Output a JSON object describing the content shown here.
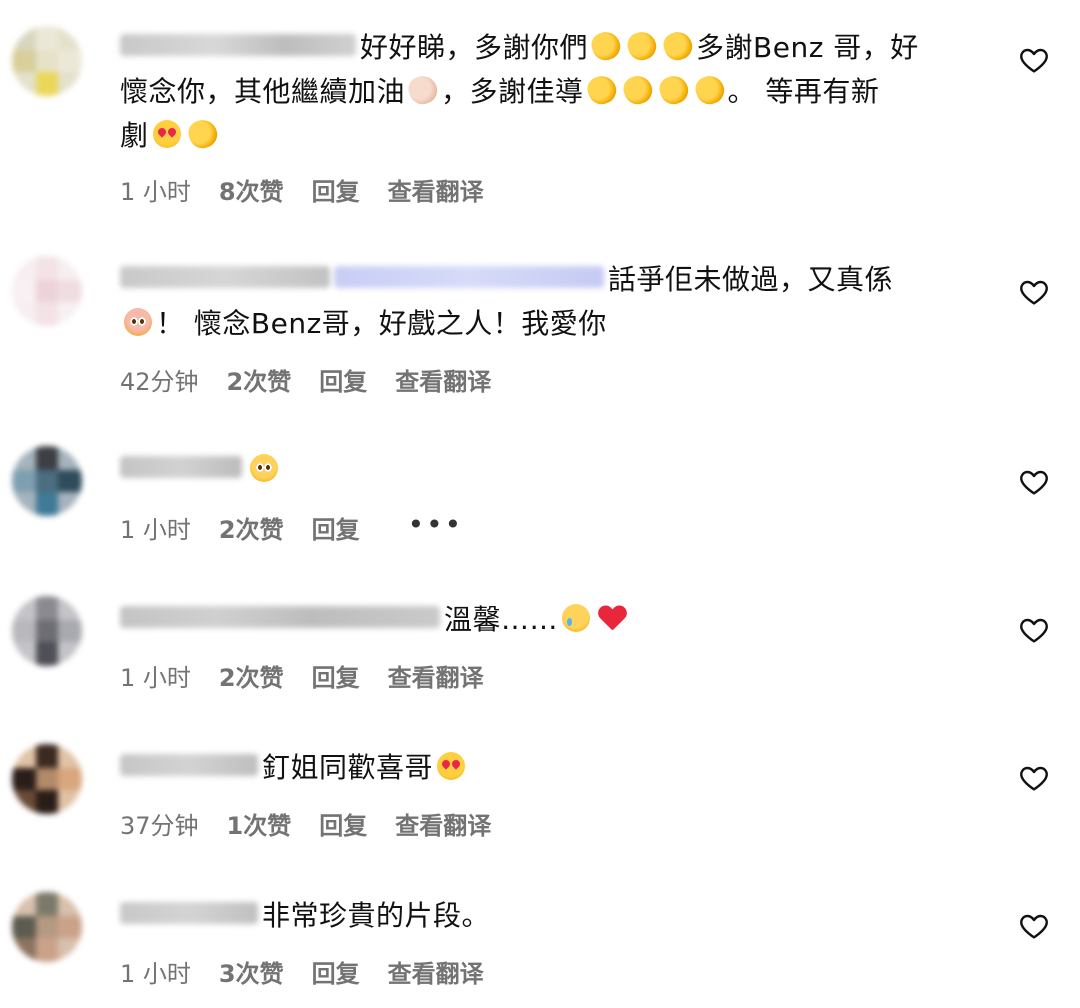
{
  "comments": [
    {
      "name_blur_colors": [
        "#c8c8c8",
        "#d8d8d8"
      ],
      "avatar_colors": [
        "#d9d6bf",
        "#ece8d8",
        "#d8cf9a",
        "#e6e2c8",
        "#ead75a",
        "#e4e1cb"
      ],
      "text_part1": "好好睇，多謝你們",
      "text_part2": "多謝Benz 哥，好",
      "text_line2a": "懷念你，其他繼續加油",
      "text_line2b": "，多謝佳導",
      "text_line2c": "。 等再有新",
      "text_line3": "劇",
      "time": "1 小时",
      "likes": "8次赞",
      "reply": "回复",
      "translate": "查看翻译"
    },
    {
      "name_blur_colors": [
        "#c9c9c9",
        "#c8cdf5"
      ],
      "avatar_colors": [
        "#f3e2e6",
        "#f6eef0",
        "#ecd3da",
        "#f8f0f2",
        "#f0dde2",
        "#f7eef0"
      ],
      "text_part1": "話爭佢未做過，又真係",
      "text_line2": "！ 懷念Benz哥，好戲之人！我愛你",
      "time": "42分钟",
      "likes": "2次赞",
      "reply": "回复",
      "translate": "查看翻译"
    },
    {
      "name_blur_colors": [
        "#c4c4c4"
      ],
      "avatar_colors": [
        "#3c3f44",
        "#4b6d80",
        "#2f4b5c",
        "#7d9fb0",
        "#3f7a96",
        "#a5b3bd"
      ],
      "time": "1 小时",
      "likes": "2次赞",
      "reply": "回复",
      "more": "•••"
    },
    {
      "name_blur_colors": [
        "#c4c4c4",
        "#cacaca"
      ],
      "avatar_colors": [
        "#8a8a90",
        "#b9b9bd",
        "#6d6d74",
        "#a9a9b0",
        "#4f4f57",
        "#c4c4c8"
      ],
      "text_part1": "溫馨……",
      "time": "1 小时",
      "likes": "2次赞",
      "reply": "回复",
      "translate": "查看翻译"
    },
    {
      "name_blur_colors": [
        "#c6c6c6"
      ],
      "avatar_colors": [
        "#3b2a22",
        "#b38a6a",
        "#2a1d18",
        "#d9a67d",
        "#6a4a36",
        "#e0c2a5"
      ],
      "text_part1": "釘姐同歡喜哥",
      "time": "37分钟",
      "likes": "1次赞",
      "reply": "回复",
      "translate": "查看翻译"
    },
    {
      "name_blur_colors": [
        "#c8c8c8"
      ],
      "avatar_colors": [
        "#7b7a6a",
        "#b59a82",
        "#5d5c50",
        "#caa28a",
        "#8d7460",
        "#d8c0ac"
      ],
      "text_part1": "非常珍貴的片段。",
      "time": "1 小时",
      "likes": "3次赞",
      "reply": "回复",
      "translate": "查看翻译"
    }
  ],
  "icons": {
    "like": "heart-outline-icon",
    "clap": "clapping-hands-emoji",
    "heart_eyes": "heart-eyes-emoji",
    "pleading": "pleading-face-emoji",
    "tear": "face-holding-back-tears-emoji",
    "red_heart": "red-heart-emoji"
  }
}
